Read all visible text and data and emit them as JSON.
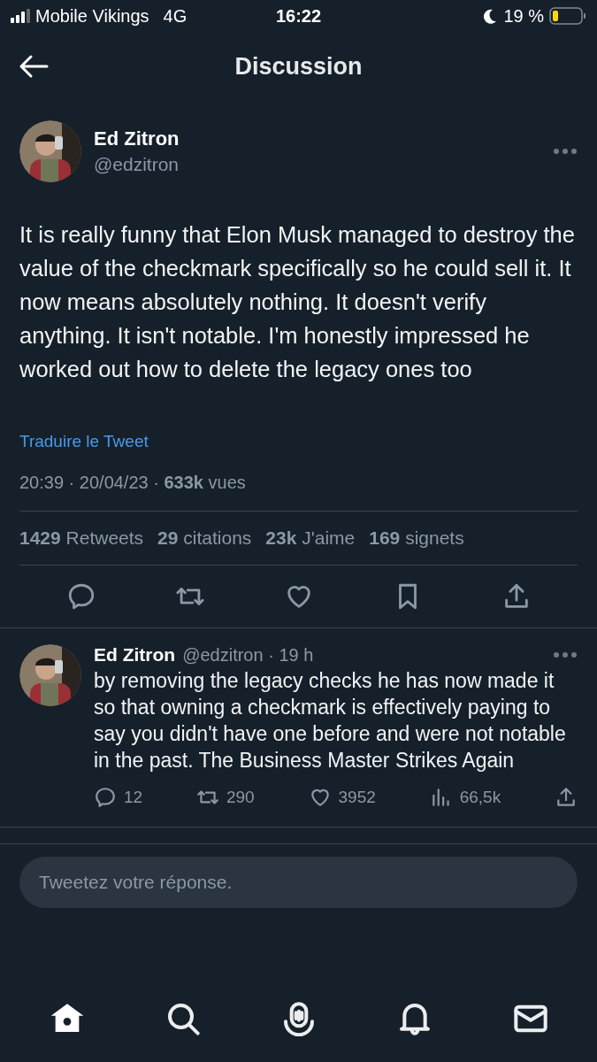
{
  "status_bar": {
    "carrier": "Mobile Vikings",
    "network": "4G",
    "time": "16:22",
    "battery": "19 %"
  },
  "header": {
    "title": "Discussion"
  },
  "tweet": {
    "name": "Ed Zitron",
    "handle": "@edzitron",
    "text": "It is really funny that Elon Musk managed to destroy the value of the checkmark specifically so he could sell it. It now means absolutely nothing. It doesn't verify anything. It isn't notable. I'm honestly impressed he worked out how to delete the legacy ones too",
    "translate": "Traduire le Tweet",
    "meta": "20:39 · 20/04/23 · **633k** vues",
    "stats": [
      "**1429** Retweets",
      "**29** citations",
      "**23k** J'aime",
      "**169** signets"
    ],
    "actions": [
      {
        "kind": "reply"
      },
      {
        "kind": "retweet"
      },
      {
        "kind": "like"
      },
      {
        "kind": "bookmark"
      },
      {
        "kind": "share"
      }
    ]
  },
  "replies": [
    {
      "name": "Ed Zitron",
      "handle": "@edzitron · 19 h",
      "text": "by removing the legacy checks he has now made it so that owning a checkmark is effectively paying to say you didn't have one before and were not notable in the past. The Business Master Strikes Again",
      "actions": [
        {
          "kind": "reply",
          "count": "12"
        },
        {
          "kind": "retweet",
          "count": "290"
        },
        {
          "kind": "like",
          "count": "3952"
        },
        {
          "kind": "views",
          "count": "66,5k"
        },
        {
          "kind": "share"
        }
      ]
    }
  ],
  "reply_field": {
    "placeholder": "Tweetez votre réponse."
  },
  "tab_bar": [
    {
      "kind": "home",
      "selected": true
    },
    {
      "kind": "search",
      "selected": false
    },
    {
      "kind": "spaces",
      "selected": false
    },
    {
      "kind": "notifications",
      "selected": false
    },
    {
      "kind": "messages",
      "selected": false
    }
  ]
}
